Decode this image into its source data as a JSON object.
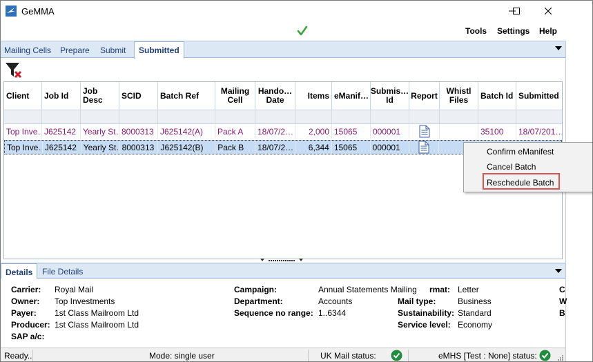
{
  "window": {
    "title": "GeMMA"
  },
  "menu": {
    "tools": "Tools",
    "settings": "Settings",
    "help": "Help"
  },
  "tabs": [
    "Mailing Cells",
    "Prepare",
    "Submit",
    "Submitted"
  ],
  "active_tab": "Submitted",
  "grid": {
    "columns": [
      "Client",
      "Job Id",
      "Job Desc",
      "SCID",
      "Batch Ref",
      "Mailing Cell",
      "Handover Date",
      "Items",
      "eManif…",
      "Submis… Id",
      "Report",
      "Whistl Files",
      "Batch Id",
      "Submitted"
    ],
    "column_display": {
      "client": "Client",
      "job_id": "Job Id",
      "job_desc": "Job\nDesc",
      "scid": "SCID",
      "batch_ref": "Batch Ref",
      "mailing_cell": "Mailing\nCell",
      "handover_date": "Hando…\nDate",
      "items": "Items",
      "emanifest": "eManif…",
      "submission_id": "Submis…\nId",
      "report": "Report",
      "whistl_files": "Whistl\nFiles",
      "batch_id": "Batch Id",
      "submitted": "Submitted"
    },
    "rows": [
      {
        "client": "Top Inve…",
        "job_id": "J625142",
        "job_desc": "Yearly St…",
        "scid": "8000313",
        "batch_ref": "J625142(A)",
        "mailing_cell": "Pack A",
        "handover_date": "18/07/2…",
        "items": "2,000",
        "emanifest": "15065",
        "submission_id": "000001",
        "report": "document-icon",
        "whistl_files": "",
        "batch_id": "35100",
        "submitted": "18/07/201…"
      },
      {
        "client": "Top Inve…",
        "job_id": "J625142",
        "job_desc": "Yearly St…",
        "scid": "8000313",
        "batch_ref": "J625142(B)",
        "mailing_cell": "Pack B",
        "handover_date": "18/07/2…",
        "items": "6,344",
        "emanifest": "15065",
        "submission_id": "000001",
        "report": "document-icon",
        "whistl_files": "",
        "batch_id": "",
        "submitted": ""
      }
    ]
  },
  "context_menu": {
    "items": [
      "Confirm eManifest",
      "Cancel Batch",
      "Reschedule Batch"
    ],
    "highlighted": "Reschedule Batch"
  },
  "details_tabs": [
    "Details",
    "File Details"
  ],
  "details": {
    "carrier_label": "Carrier:",
    "carrier": "Royal Mail",
    "owner_label": "Owner:",
    "owner": "Top Investments",
    "payer_label": "Payer:",
    "payer": "1st Class Mailroom Ltd",
    "producer_label": "Producer:",
    "producer": "1st Class Mailroom Ltd",
    "sap_label": "SAP a/c:",
    "sap": "",
    "campaign_label": "Campaign:",
    "campaign": "Annual Statements Mailing",
    "department_label": "Department:",
    "department": "Accounts",
    "sequence_label": "Sequence no range:",
    "sequence": "1..6344",
    "format_label": "rmat:",
    "format": "Letter",
    "mail_type_label": "Mail type:",
    "mail_type": "Business",
    "sustainability_label": "Sustainability:",
    "sustainability": "Standard",
    "service_level_label": "Service level:",
    "service_level": "Economy",
    "clipped_col_1": "C",
    "clipped_col_2": "W",
    "clipped_col_3": "B"
  },
  "statusbar": {
    "ready": "Ready..",
    "mode": "Mode: single user",
    "uk_mail": "UK Mail status:",
    "emhs": "eMHS [Test : None] status:"
  },
  "colors": {
    "tab_bar": "#dde8f5",
    "row_text_first": "#8a1a6e",
    "selected_row": "#c6dcf5",
    "status_ok": "#1e8e3e",
    "highlight_box": "#d9534f"
  }
}
